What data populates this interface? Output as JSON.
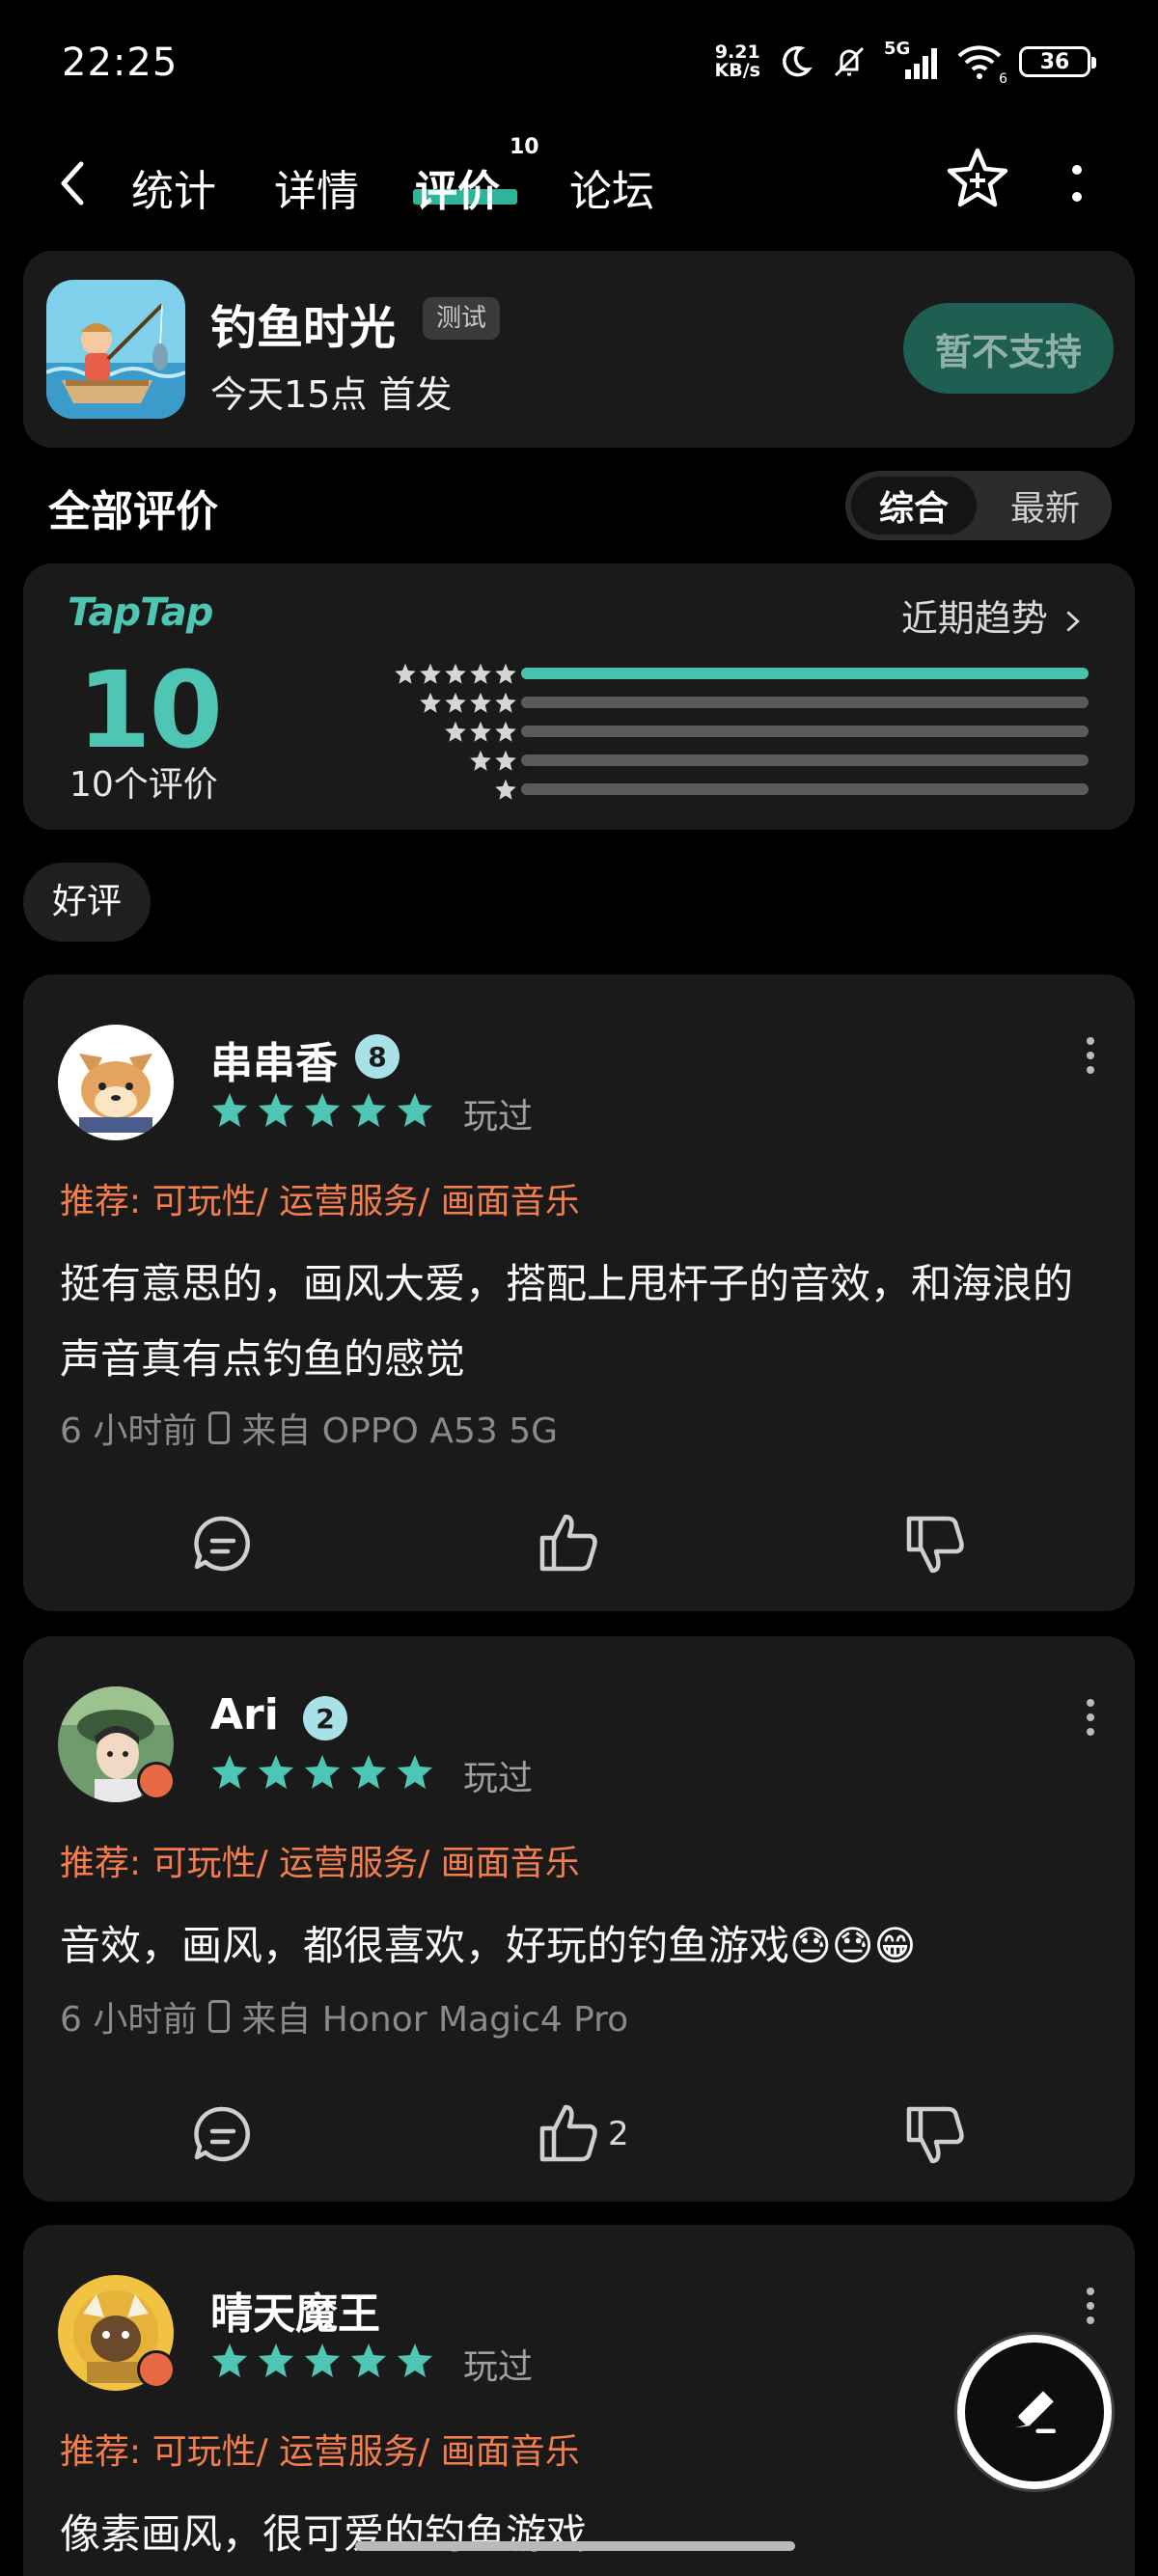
{
  "status_bar": {
    "time": "22:25",
    "net_speed_value": "9.21",
    "net_speed_unit": "KB/s",
    "network": "5G",
    "wifi_sub": "6",
    "battery": "36"
  },
  "nav": {
    "tabs": [
      {
        "label": "统计"
      },
      {
        "label": "详情"
      },
      {
        "label": "评价",
        "badge": "10"
      },
      {
        "label": "论坛"
      }
    ]
  },
  "app": {
    "name": "钓鱼时光",
    "tag": "测试",
    "release": "今天15点 首发",
    "button": "暂不支持"
  },
  "section": {
    "title": "全部评价",
    "sort_options": [
      "综合",
      "最新"
    ]
  },
  "rating": {
    "brand": "TapTap",
    "score": "10",
    "count_label": "10个评价",
    "trend_link": "近期趋势",
    "distribution": [
      1.0,
      0,
      0,
      0,
      0
    ]
  },
  "filter": {
    "chip": "好评"
  },
  "reviews": [
    {
      "user": "串串香",
      "level": "8",
      "stars": 5,
      "played": "玩过",
      "tags": "推荐: 可玩性/ 运营服务/ 画面音乐",
      "text": "挺有意思的，画风大爱，搭配上甩杆子的音效，和海浪的声音真有点钓鱼的感觉",
      "time": "6 小时前",
      "device": "来自 OPPO A53 5G",
      "likes": ""
    },
    {
      "user": "Ari",
      "level": "2",
      "stars": 5,
      "played": "玩过",
      "tags": "推荐: 可玩性/ 运营服务/ 画面音乐",
      "text": "音效，画风，都很喜欢，好玩的钓鱼游戏😓😓😁",
      "time": "6 小时前",
      "device": "来自 Honor Magic4 Pro",
      "likes": "2"
    },
    {
      "user": "晴天魔王",
      "level": "",
      "stars": 5,
      "played": "玩过",
      "tags": "推荐: 可玩性/ 运营服务/ 画面音乐",
      "text": "像素画风，很可爱的钓鱼游戏",
      "time": "",
      "device": "",
      "likes": ""
    }
  ],
  "colors": {
    "accent": "#4fc6b3",
    "tag_orange": "#f47f4c",
    "card_bg": "#1a1a1a",
    "button_disabled": "#1f5f52"
  }
}
